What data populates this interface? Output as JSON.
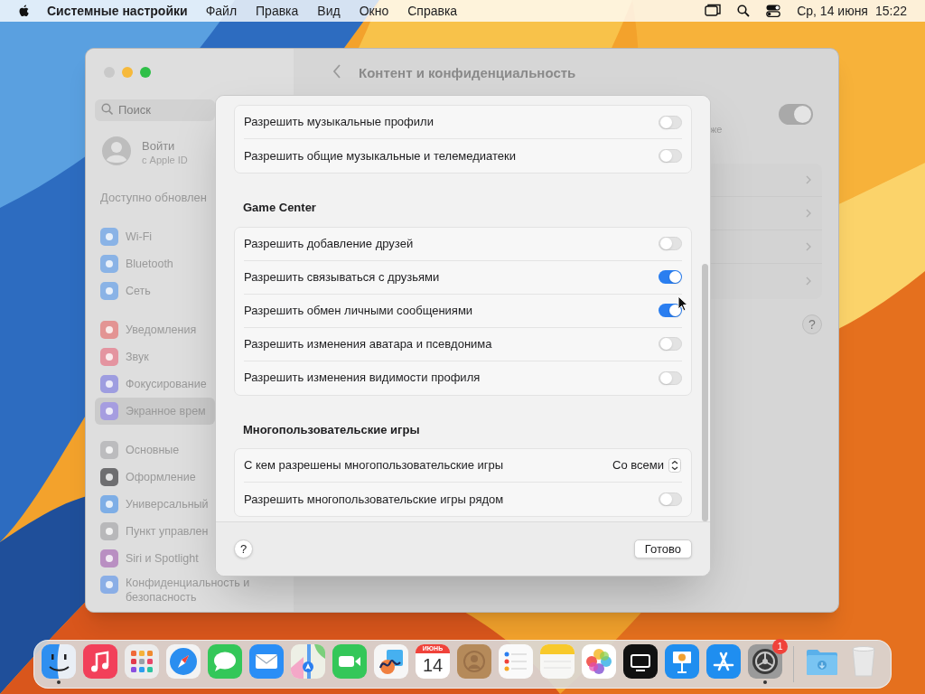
{
  "menu_bar": {
    "app": "Системные настройки",
    "menus": [
      "Файл",
      "Правка",
      "Вид",
      "Окно",
      "Справка"
    ],
    "date": "Ср, 14 июня",
    "time": "15:22"
  },
  "window": {
    "title": "Контент и конфиденциальность",
    "search": {
      "placeholder": "Поиск"
    },
    "account": {
      "name": "Войти",
      "subtitle": "с Apple ID"
    },
    "notice": "Доступно обновлен",
    "sidebar": {
      "groups": [
        [
          {
            "label": "Wi-Fi",
            "color": "#8ab3e6",
            "selected": false
          },
          {
            "label": "Bluetooth",
            "color": "#8ab3e6",
            "selected": false
          },
          {
            "label": "Сеть",
            "color": "#8ab3e6",
            "selected": false
          }
        ],
        [
          {
            "label": "Уведомления",
            "color": "#e39493",
            "selected": false
          },
          {
            "label": "Звук",
            "color": "#e494a0",
            "selected": false
          },
          {
            "label": "Фокусирование",
            "color": "#9e9de0",
            "selected": false
          },
          {
            "label": "Экранное врем",
            "color": "#a69de0",
            "selected": true
          }
        ],
        [
          {
            "label": "Основные",
            "color": "#bcbcbe",
            "selected": false
          },
          {
            "label": "Оформление",
            "color": "#6e6e70",
            "selected": false
          },
          {
            "label": "Универсальный",
            "color": "#7eaee6",
            "selected": false
          },
          {
            "label": "Пункт управлен",
            "color": "#b8b8ba",
            "selected": false
          },
          {
            "label": "Siri и Spotlight",
            "color": "#b98fc2",
            "selected": false
          },
          {
            "label": "Конфиденциальность и безопасность",
            "color": "#8aaee6",
            "selected": false
          }
        ]
      ]
    },
    "background": {
      "fragment": "же",
      "toggle": {
        "on": true
      },
      "help": "?"
    }
  },
  "sheet": {
    "sections": [
      {
        "rows": [
          {
            "kind": "toggle",
            "label": "Разрешить музыкальные профили",
            "on": false
          },
          {
            "kind": "toggle",
            "label": "Разрешить общие музыкальные и телемедиатеки",
            "on": false
          }
        ]
      },
      {
        "title": "Game Center",
        "rows": [
          {
            "kind": "toggle",
            "label": "Разрешить добавление друзей",
            "on": false
          },
          {
            "kind": "toggle",
            "label": "Разрешить связываться с друзьями",
            "on": true
          },
          {
            "kind": "toggle",
            "label": "Разрешить обмен личными сообщениями",
            "on": true
          },
          {
            "kind": "toggle",
            "label": "Разрешить изменения аватара и псевдонима",
            "on": false
          },
          {
            "kind": "toggle",
            "label": "Разрешить изменения видимости профиля",
            "on": false
          }
        ]
      },
      {
        "title": "Многопользовательские игры",
        "rows": [
          {
            "kind": "popup",
            "label": "С кем разрешены многопользовательские игры",
            "value": "Со всеми"
          },
          {
            "kind": "toggle",
            "label": "Разрешить многопользовательские игры рядом",
            "on": false
          }
        ]
      }
    ],
    "help": "?",
    "done": "Готово"
  },
  "dock": [
    {
      "kind": "finder",
      "running": true
    },
    {
      "kind": "music",
      "running": false
    },
    {
      "kind": "launchpad",
      "running": false
    },
    {
      "kind": "safari",
      "running": false
    },
    {
      "kind": "messages",
      "running": false
    },
    {
      "kind": "mail",
      "running": false
    },
    {
      "kind": "maps",
      "running": false
    },
    {
      "kind": "facetime",
      "running": false
    },
    {
      "kind": "freeform",
      "running": false
    },
    {
      "kind": "calendar",
      "month": "ИЮНЬ",
      "day": "14",
      "running": false
    },
    {
      "kind": "contacts",
      "running": false
    },
    {
      "kind": "reminders",
      "running": false
    },
    {
      "kind": "notes",
      "running": false
    },
    {
      "kind": "photos",
      "running": false
    },
    {
      "kind": "tv",
      "running": false
    },
    {
      "kind": "keynote",
      "running": false
    },
    {
      "kind": "appstore",
      "running": false
    },
    {
      "kind": "settings",
      "running": true,
      "badge": "1"
    },
    {
      "kind": "separator"
    },
    {
      "kind": "folder",
      "running": false
    },
    {
      "kind": "trash",
      "running": false
    }
  ]
}
